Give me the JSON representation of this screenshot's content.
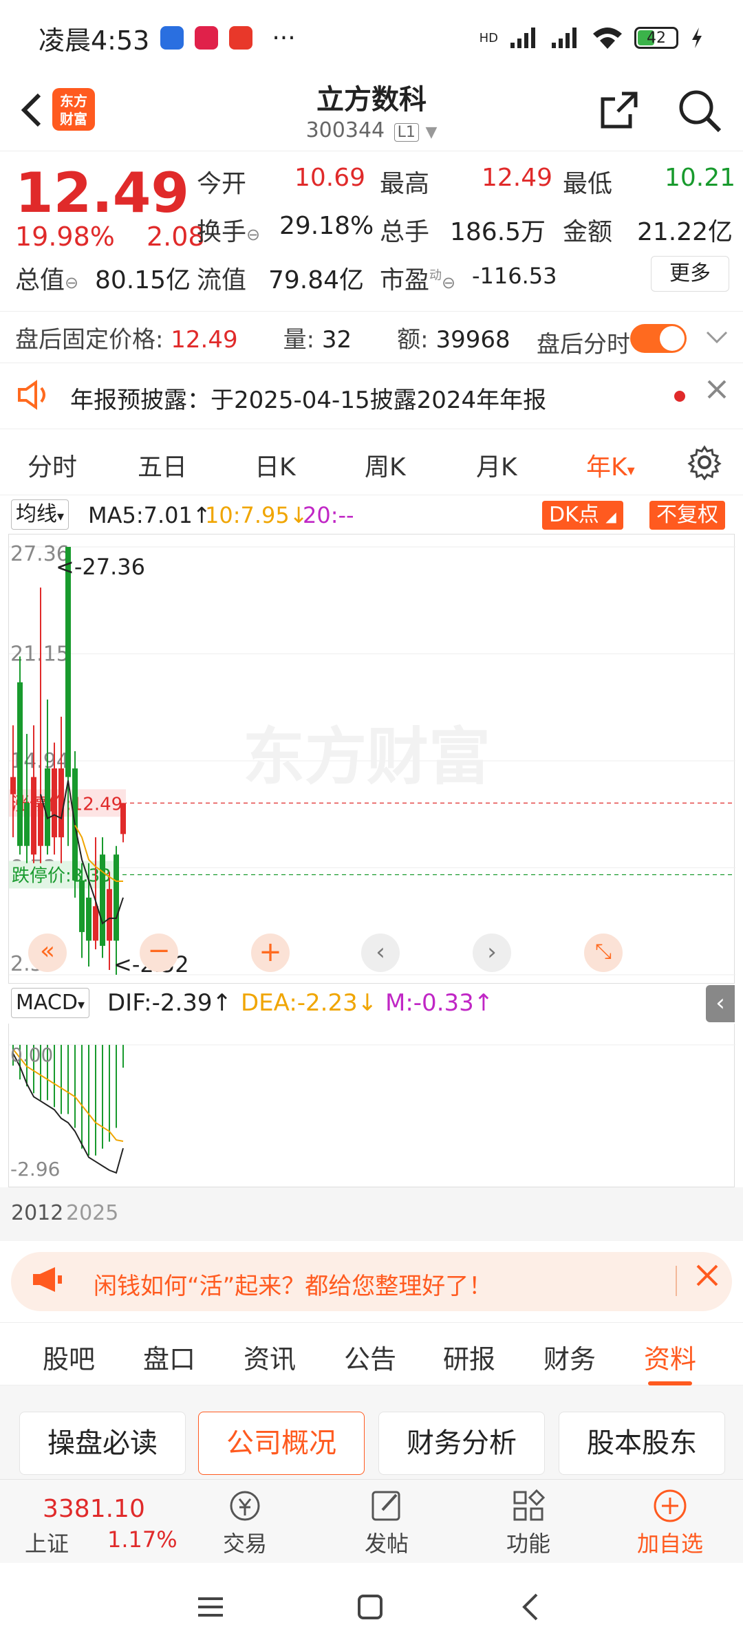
{
  "status": {
    "time": "凌晨4:53",
    "dots": "···",
    "battery": "42",
    "hd": "HD"
  },
  "header": {
    "app_logo": "东方\n财富",
    "stock_name": "立方数科",
    "stock_code": "300344",
    "level": "L1"
  },
  "quote": {
    "price": "12.49",
    "change_pct": "19.98%",
    "change_abs": "2.08",
    "open_label": "今开",
    "open": "10.69",
    "high_label": "最高",
    "high": "12.49",
    "low_label": "最低",
    "low": "10.21",
    "turnover_label": "换手",
    "turnover": "29.18%",
    "volume_label": "总手",
    "volume": "186.5万",
    "amount_label": "金额",
    "amount": "21.22亿",
    "mktcap_label": "总值",
    "mktcap": "80.15亿",
    "float_label": "流值",
    "float_cap": "79.84亿",
    "pe_label": "市盈",
    "pe_sup": "动",
    "pe": "-116.53",
    "more_label": "更多"
  },
  "afterhours": {
    "label": "盘后固定价格:",
    "price": "12.49",
    "vol_label": "量:",
    "vol": "32",
    "amt_label": "额:",
    "amt": "39968",
    "toggle_label": "盘后分时"
  },
  "notice": {
    "text": "年报预披露：于2025-04-15披露2024年年报"
  },
  "period_tabs": [
    {
      "label": "分时"
    },
    {
      "label": "五日"
    },
    {
      "label": "日K"
    },
    {
      "label": "周K"
    },
    {
      "label": "月K"
    },
    {
      "label": "年K"
    }
  ],
  "period_active_arrow": "▾",
  "ma": {
    "selector": "均线",
    "ma5": "MA5:7.01↑",
    "ma10": "10:7.95↓",
    "ma20": "20:--",
    "dk_label": "DK点",
    "fq_label": "不复权"
  },
  "kchart": {
    "y_labels": [
      "27.36",
      "21.15",
      "14.94",
      "8.73",
      "2.52"
    ],
    "max_label": "<-27.36",
    "min_label": "<-2.52",
    "limit_up_label": "涨停价:12.49",
    "limit_down_label": "跌停价:8.33",
    "watermark": "东方财富",
    "candles": [
      {
        "o": 14.0,
        "c": 13.0,
        "h": 17.0,
        "l": 10.5,
        "color": "red"
      },
      {
        "o": 10.0,
        "c": 19.5,
        "h": 21.0,
        "l": 9.5,
        "color": "green"
      },
      {
        "o": 12.5,
        "c": 10.0,
        "h": 16.5,
        "l": 9.0,
        "color": "green"
      },
      {
        "o": 9.5,
        "c": 14.0,
        "h": 17.0,
        "l": 9.0,
        "color": "red"
      },
      {
        "o": 10.0,
        "c": 12.5,
        "h": 25.0,
        "l": 9.0,
        "color": "red"
      },
      {
        "o": 14.5,
        "c": 10.0,
        "h": 18.5,
        "l": 9.5,
        "color": "green"
      },
      {
        "o": 10.5,
        "c": 14.5,
        "h": 16.0,
        "l": 9.5,
        "color": "red"
      },
      {
        "o": 14.5,
        "c": 10.5,
        "h": 17.5,
        "l": 9.0,
        "color": "red"
      },
      {
        "o": 27.36,
        "c": 14.0,
        "h": 27.36,
        "l": 10.0,
        "color": "green"
      },
      {
        "o": 14.5,
        "c": 8.0,
        "h": 15.5,
        "l": 7.0,
        "color": "green"
      },
      {
        "o": 8.0,
        "c": 5.0,
        "h": 9.0,
        "l": 3.5,
        "color": "green"
      },
      {
        "o": 7.0,
        "c": 4.5,
        "h": 9.0,
        "l": 3.0,
        "color": "green"
      },
      {
        "o": 4.5,
        "c": 6.5,
        "h": 10.5,
        "l": 4.0,
        "color": "red"
      },
      {
        "o": 9.5,
        "c": 4.2,
        "h": 10.5,
        "l": 3.5,
        "color": "green"
      },
      {
        "o": 4.5,
        "c": 7.5,
        "h": 8.5,
        "l": 2.8,
        "color": "red"
      },
      {
        "o": 9.5,
        "c": 4.5,
        "h": 10.0,
        "l": 2.52,
        "color": "green"
      },
      {
        "o": 10.69,
        "c": 12.49,
        "h": 12.49,
        "l": 10.21,
        "color": "red"
      }
    ],
    "ma5": [
      null,
      null,
      null,
      null,
      13.0,
      11.6,
      11.8,
      11.6,
      13.8,
      11.2,
      9.2,
      8.0,
      6.8,
      5.5,
      5.8,
      5.8,
      7.0
    ],
    "ma10": [
      null,
      null,
      null,
      null,
      null,
      null,
      null,
      null,
      null,
      11.2,
      10.5,
      9.2,
      8.8,
      8.5,
      8.2,
      7.95,
      7.95
    ]
  },
  "macd": {
    "selector": "MACD",
    "dif": "DIF:-2.39↑",
    "dea": "DEA:-2.23↓",
    "m": "M:-0.33↑",
    "y_labels": [
      "0.00",
      "-2.96"
    ],
    "bars": [
      -0.3,
      -0.5,
      -0.6,
      -0.7,
      -0.8,
      -0.8,
      -0.9,
      -1.0,
      -1.0,
      -1.2,
      -1.5,
      -1.6,
      -1.6,
      -1.5,
      -1.4,
      -1.2,
      -0.33
    ],
    "dif_line": [
      -0.2,
      -0.5,
      -0.9,
      -1.2,
      -1.3,
      -1.4,
      -1.5,
      -1.7,
      -1.8,
      -2.0,
      -2.3,
      -2.6,
      -2.7,
      -2.8,
      -2.9,
      -2.96,
      -2.39
    ],
    "dea_line": [
      -0.1,
      -0.3,
      -0.5,
      -0.6,
      -0.7,
      -0.8,
      -0.9,
      -1.0,
      -1.1,
      -1.2,
      -1.4,
      -1.6,
      -1.8,
      -1.9,
      -2.0,
      -2.2,
      -2.23
    ]
  },
  "x_axis": {
    "start": "2012",
    "end": "2025"
  },
  "promo": {
    "text": "闲钱如何“活”起来？都给您整理好了！"
  },
  "bottom_tabs": [
    {
      "label": "股吧"
    },
    {
      "label": "盘口"
    },
    {
      "label": "资讯"
    },
    {
      "label": "公告"
    },
    {
      "label": "研报"
    },
    {
      "label": "财务"
    },
    {
      "label": "资料"
    }
  ],
  "sections": [
    {
      "label": "操盘必读"
    },
    {
      "label": "公司概况"
    },
    {
      "label": "财务分析"
    },
    {
      "label": "股本股东"
    }
  ],
  "dock": {
    "index_value": "3381.10",
    "index_name": "上证",
    "index_pct": "1.17%",
    "items": [
      {
        "label": "交易"
      },
      {
        "label": "发帖"
      },
      {
        "label": "功能"
      },
      {
        "label": "加自选"
      }
    ]
  },
  "colors": {
    "up": "#e02a2a",
    "down": "#189a2d",
    "accent": "#ff5a1f",
    "ma10": "#f0a500",
    "ma20": "#c026c5"
  }
}
